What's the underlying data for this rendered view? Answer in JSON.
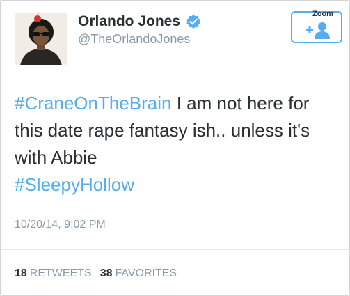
{
  "user": {
    "display_name": "Orlando Jones",
    "handle": "@TheOrlandoJones",
    "verified": true
  },
  "header": {
    "zoom_label": "Zoom",
    "follow_icon": "follow-user-icon"
  },
  "tweet": {
    "hashtag1": "#CraneOnTheBrain",
    "text_part1": " I am not here for this date rape fantasy ish.. unless it's with Abbie",
    "hashtag2": "#SleepyHollow",
    "timestamp": "10/20/14, 9:02 PM"
  },
  "stats": {
    "retweets_count": "18",
    "retweets_label": "RETWEETS",
    "favorites_count": "38",
    "favorites_label": "FAVORITES"
  },
  "colors": {
    "accent": "#55acee",
    "text": "#292f33",
    "muted": "#8899a6"
  }
}
